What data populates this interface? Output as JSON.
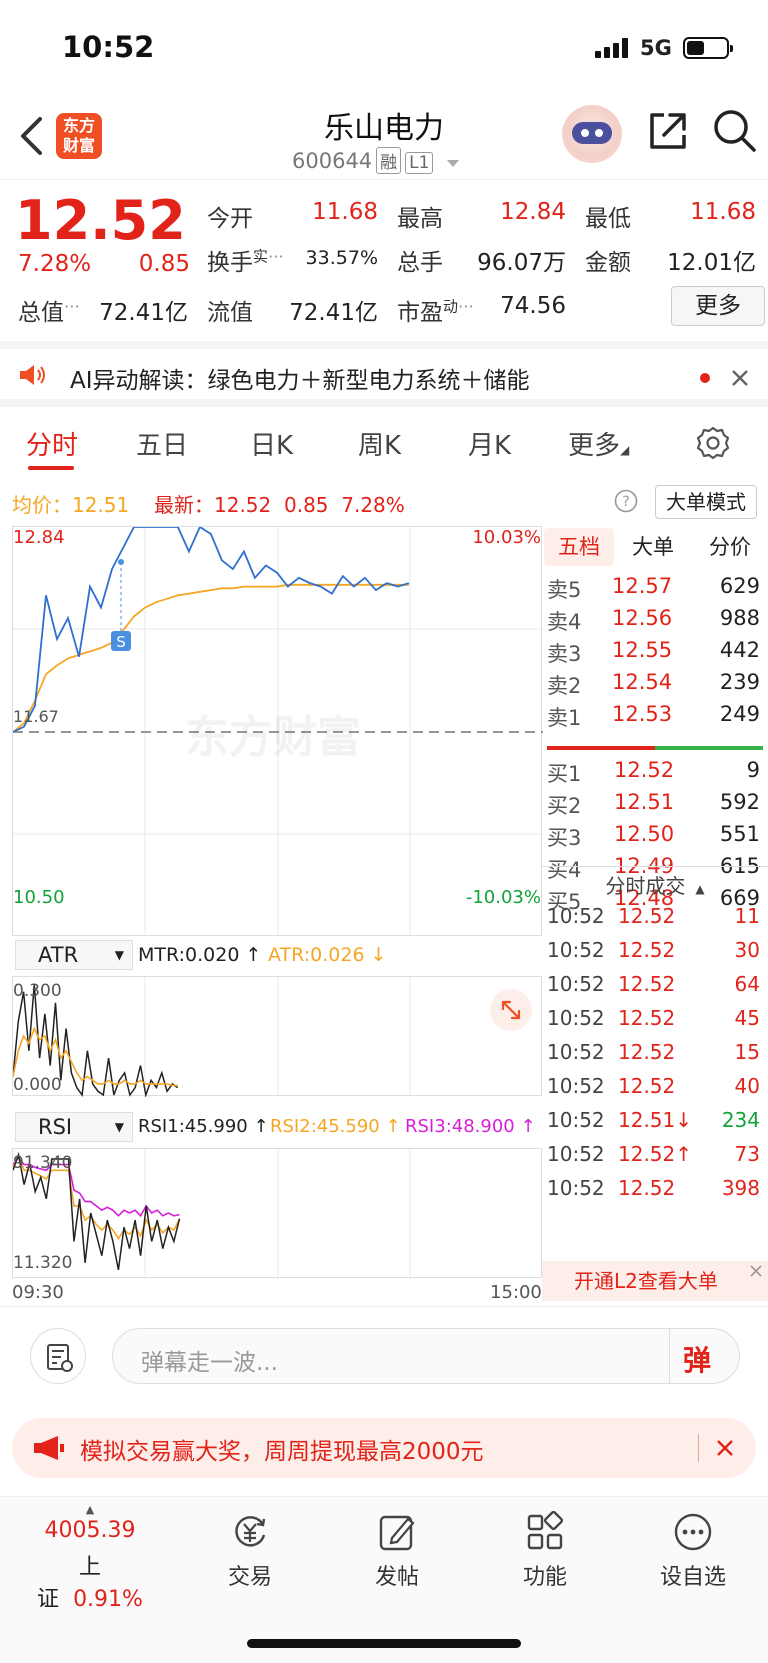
{
  "status_bar": {
    "time": "10:52",
    "network": "5G"
  },
  "header": {
    "logo_line1": "东方",
    "logo_line2": "财富",
    "stock_name": "乐山电力",
    "stock_code": "600644",
    "tag_margin": "融",
    "tag_level": "L1"
  },
  "quote": {
    "price": "12.52",
    "change_pct": "7.28%",
    "change": "0.85",
    "open_label": "今开",
    "open": "11.68",
    "high_label": "最高",
    "high": "12.84",
    "low_label": "最低",
    "low": "11.68",
    "turnover_label": "换手",
    "turnover_sup": "实",
    "turnover": "33.57%",
    "volume_label": "总手",
    "volume": "96.07万",
    "amount_label": "金额",
    "amount": "12.01亿",
    "mktcap_label": "总值",
    "mktcap": "72.41亿",
    "float_label": "流值",
    "float_cap": "72.41亿",
    "pe_label": "市盈",
    "pe_sup": "动",
    "pe": "74.56",
    "more_label": "更多"
  },
  "ai_bar": {
    "text": "AI异动解读：绿色电力＋新型电力系统＋储能"
  },
  "tabs": [
    "分时",
    "五日",
    "日K",
    "周K",
    "月K",
    "更多"
  ],
  "infobar": {
    "avg_label": "均价：",
    "avg": "12.51",
    "latest_label": "最新：",
    "latest": "12.52",
    "latest_chg": "0.85",
    "latest_pct": "7.28%",
    "mode_label": "大单模式"
  },
  "chart_data": {
    "type": "line",
    "price_axis": {
      "top": "12.84",
      "mid": "11.67",
      "bottom": "10.50",
      "top_pct": "10.03%",
      "bottom_pct": "-10.03%"
    },
    "time_axis": {
      "start": "09:30",
      "end": "15:00"
    },
    "watermark": "东方财富",
    "marker_label": "S",
    "series": [
      {
        "name": "price",
        "color": "#2f6fd0",
        "values": [
          11.67,
          11.7,
          11.82,
          12.45,
          12.2,
          12.32,
          12.1,
          12.5,
          12.38,
          12.6,
          12.72,
          12.84,
          12.84,
          12.84,
          12.84,
          12.84,
          12.7,
          12.84,
          12.8,
          12.65,
          12.6,
          12.7,
          12.55,
          12.62,
          12.58,
          12.5,
          12.55,
          12.52,
          12.5,
          12.46,
          12.56,
          12.5,
          12.55,
          12.48,
          12.52,
          12.5,
          12.52
        ]
      },
      {
        "name": "avg",
        "color": "#f5a623",
        "values": [
          11.67,
          11.72,
          11.85,
          12.0,
          12.05,
          12.09,
          12.11,
          12.13,
          12.15,
          12.18,
          12.25,
          12.33,
          12.38,
          12.41,
          12.43,
          12.45,
          12.46,
          12.47,
          12.48,
          12.49,
          12.49,
          12.5,
          12.5,
          12.5,
          12.5,
          12.51,
          12.51,
          12.51,
          12.51,
          12.51,
          12.51,
          12.51,
          12.51,
          12.51,
          12.51,
          12.51,
          12.51
        ]
      }
    ]
  },
  "atr": {
    "select": "ATR",
    "mtr_text": "MTR:0.020 ↑",
    "atr_text": "ATR:0.026 ↓",
    "axis_top": "0.300",
    "axis_bottom": "0.000",
    "mtr_values": [
      0.05,
      0.2,
      0.28,
      0.12,
      0.3,
      0.1,
      0.22,
      0.08,
      0.25,
      0.04,
      0.18,
      0.06,
      0.02,
      0.0,
      0.12,
      0.03,
      0.01,
      0.0,
      0.1,
      0.0,
      0.04,
      0.06,
      0.0,
      0.02,
      0.08,
      0.0,
      0.04,
      0.02,
      0.06,
      0.01,
      0.03,
      0.02
    ],
    "atr_values": [
      0.05,
      0.12,
      0.16,
      0.14,
      0.18,
      0.15,
      0.16,
      0.12,
      0.15,
      0.1,
      0.12,
      0.09,
      0.06,
      0.04,
      0.05,
      0.04,
      0.03,
      0.03,
      0.04,
      0.03,
      0.03,
      0.04,
      0.03,
      0.03,
      0.04,
      0.03,
      0.03,
      0.03,
      0.03,
      0.03,
      0.026,
      0.026
    ]
  },
  "rsi": {
    "select": "RSI",
    "rsi1_text": "RSI1:45.990 ↑",
    "rsi2_text": "RSI2:45.590 ↑",
    "rsi3_text": "RSI3:48.900 ↑",
    "axis_top": "91.340",
    "axis_bottom": "11.320",
    "rsi1_values": [
      80,
      91,
      70,
      85,
      65,
      75,
      60,
      88,
      88,
      88,
      88,
      30,
      60,
      15,
      50,
      35,
      20,
      45,
      30,
      10,
      40,
      25,
      45,
      20,
      55,
      30,
      45,
      25,
      40,
      30,
      46
    ],
    "rsi2_values": [
      82,
      90,
      80,
      80,
      78,
      76,
      74,
      80,
      80,
      80,
      80,
      55,
      55,
      45,
      48,
      42,
      38,
      42,
      38,
      32,
      38,
      35,
      40,
      34,
      45,
      38,
      42,
      36,
      40,
      38,
      45.6
    ],
    "rsi3_values": [
      84,
      89,
      84,
      84,
      82,
      81,
      80,
      84,
      84,
      84,
      84,
      66,
      64,
      58,
      58,
      55,
      52,
      54,
      52,
      48,
      52,
      50,
      52,
      48,
      55,
      50,
      52,
      48,
      50,
      48,
      48.9
    ]
  },
  "orderbook": {
    "tabs": [
      "五档",
      "大单",
      "分价"
    ],
    "asks": [
      {
        "label": "卖5",
        "price": "12.57",
        "vol": "629"
      },
      {
        "label": "卖4",
        "price": "12.56",
        "vol": "988"
      },
      {
        "label": "卖3",
        "price": "12.55",
        "vol": "442"
      },
      {
        "label": "卖2",
        "price": "12.54",
        "vol": "239"
      },
      {
        "label": "卖1",
        "price": "12.53",
        "vol": "249"
      }
    ],
    "bids": [
      {
        "label": "买1",
        "price": "12.52",
        "vol": "9"
      },
      {
        "label": "买2",
        "price": "12.51",
        "vol": "592"
      },
      {
        "label": "买3",
        "price": "12.50",
        "vol": "551"
      },
      {
        "label": "买4",
        "price": "12.49",
        "vol": "615"
      },
      {
        "label": "买5",
        "price": "12.48",
        "vol": "669"
      }
    ],
    "trades_title": "分时成交",
    "trades": [
      {
        "time": "10:52",
        "price": "12.52",
        "vol": "11"
      },
      {
        "time": "10:52",
        "price": "12.52",
        "vol": "30"
      },
      {
        "time": "10:52",
        "price": "12.52",
        "vol": "64"
      },
      {
        "time": "10:52",
        "price": "12.52",
        "vol": "45"
      },
      {
        "time": "10:52",
        "price": "12.52",
        "vol": "15"
      },
      {
        "time": "10:52",
        "price": "12.52",
        "vol": "40"
      },
      {
        "time": "10:52",
        "price": "12.51↓",
        "vol": "234"
      },
      {
        "time": "10:52",
        "price": "12.52↑",
        "vol": "73"
      },
      {
        "time": "10:52",
        "price": "12.52",
        "vol": "398"
      }
    ],
    "l2_text": "开通L2查看大单"
  },
  "comment": {
    "placeholder": "弹幕走一波...",
    "danmu_btn": "弹"
  },
  "promo": {
    "text": "模拟交易赢大奖，周周提现最高2000元"
  },
  "nav": {
    "index_value": "4005.39",
    "index_name": "上证",
    "index_pct": "0.91%",
    "items": [
      "交易",
      "发帖",
      "功能",
      "设自选"
    ]
  }
}
